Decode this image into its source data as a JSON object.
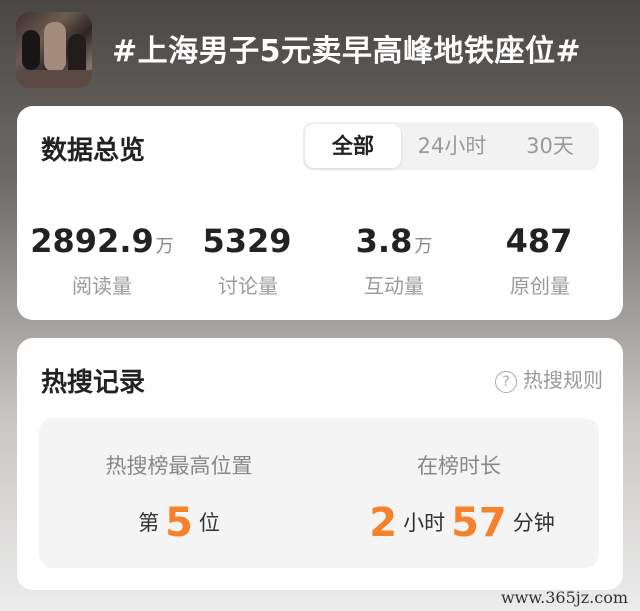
{
  "header": {
    "title": "#上海男子5元卖早高峰地铁座位#"
  },
  "overview": {
    "title": "数据总览",
    "tabs": [
      {
        "label": "全部",
        "active": true
      },
      {
        "label": "24小时",
        "active": false
      },
      {
        "label": "30天",
        "active": false
      }
    ],
    "stats": [
      {
        "value": "2892.9",
        "unit": "万",
        "label": "阅读量"
      },
      {
        "value": "5329",
        "unit": "",
        "label": "讨论量"
      },
      {
        "value": "3.8",
        "unit": "万",
        "label": "互动量"
      },
      {
        "value": "487",
        "unit": "",
        "label": "原创量"
      }
    ]
  },
  "hot_search": {
    "title": "热搜记录",
    "rules_label": "热搜规则",
    "rules_icon": "question-circle-icon",
    "highest_position": {
      "label": "热搜榜最高位置",
      "prefix": "第",
      "value": "5",
      "suffix": "位"
    },
    "duration": {
      "label": "在榜时长",
      "hours": "2",
      "hours_unit": "小时",
      "minutes": "57",
      "minutes_unit": "分钟"
    }
  },
  "watermark": "www.365jz.com",
  "colors": {
    "accent": "#f5812a",
    "text_primary": "#222222",
    "text_secondary": "#9a9a9a"
  }
}
